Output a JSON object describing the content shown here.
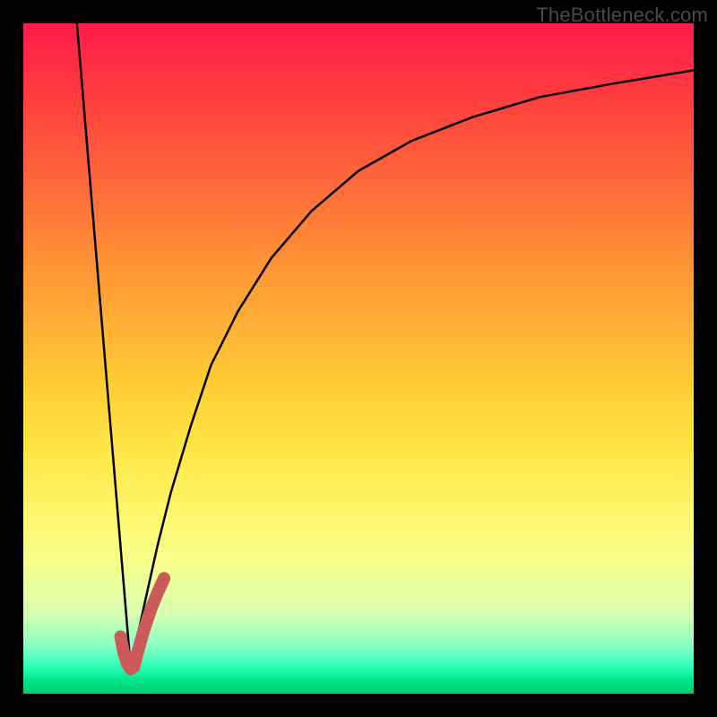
{
  "attribution": "TheBottleneck.com",
  "chart_data": {
    "type": "line",
    "title": "",
    "xlabel": "",
    "ylabel": "",
    "xlim": [
      0,
      100
    ],
    "ylim": [
      0,
      100
    ],
    "grid": false,
    "legend": false,
    "series": [
      {
        "name": "left-branch",
        "x": [
          8,
          16
        ],
        "y": [
          100,
          4
        ],
        "stroke": "#000000",
        "width": 2.5
      },
      {
        "name": "right-branch",
        "x": [
          16,
          18,
          20,
          22,
          25,
          28,
          32,
          37,
          43,
          50,
          58,
          67,
          77,
          88,
          100
        ],
        "y": [
          4,
          13,
          22,
          30,
          40,
          49,
          57,
          65,
          72,
          78,
          82.5,
          86,
          89,
          91,
          93
        ],
        "stroke": "#000000",
        "width": 2.5
      },
      {
        "name": "highlight-hook",
        "x": [
          14.5,
          15.0,
          15.5,
          16.0,
          16.5,
          17.0,
          18.0,
          19.0,
          20.0,
          21.0
        ],
        "y": [
          8.5,
          6.0,
          4.5,
          3.7,
          4.0,
          6.0,
          9.5,
          12.5,
          15.0,
          17.2
        ],
        "stroke": "#cc5a5a",
        "width": 14
      }
    ],
    "background_gradient": [
      {
        "stop": 0.0,
        "color": "#ff1a4b"
      },
      {
        "stop": 0.55,
        "color": "#ffd035"
      },
      {
        "stop": 0.8,
        "color": "#f7ff8a"
      },
      {
        "stop": 1.0,
        "color": "#00c96e"
      }
    ]
  }
}
